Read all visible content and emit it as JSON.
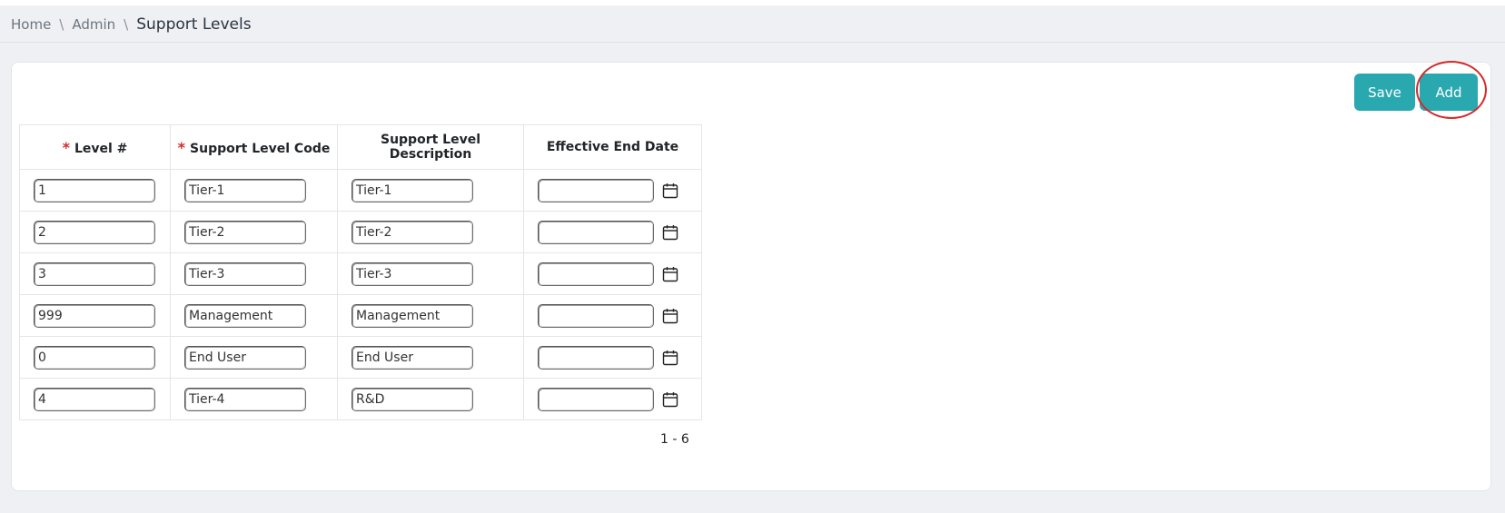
{
  "breadcrumb": {
    "home": "Home",
    "admin": "Admin",
    "current": "Support Levels",
    "separator": "\\"
  },
  "toolbar": {
    "save_label": "Save",
    "add_label": "Add"
  },
  "table": {
    "columns": [
      {
        "label": "Level #",
        "required": true
      },
      {
        "label": "Support Level Code",
        "required": true
      },
      {
        "label": "Support Level Description",
        "required": false
      },
      {
        "label": "Effective End Date",
        "required": false
      }
    ],
    "required_marker": "*",
    "rows": [
      {
        "level": "1",
        "code": "Tier-1",
        "description": "Tier-1",
        "end_date": ""
      },
      {
        "level": "2",
        "code": "Tier-2",
        "description": "Tier-2",
        "end_date": ""
      },
      {
        "level": "3",
        "code": "Tier-3",
        "description": "Tier-3",
        "end_date": ""
      },
      {
        "level": "999",
        "code": "Management",
        "description": "Management",
        "end_date": ""
      },
      {
        "level": "0",
        "code": "End User",
        "description": "End User",
        "end_date": ""
      },
      {
        "level": "4",
        "code": "Tier-4",
        "description": "R&D",
        "end_date": ""
      }
    ]
  },
  "pagination": {
    "range": "1 - 6"
  },
  "colors": {
    "accent": "#2aa8af",
    "required": "#d42a2a",
    "highlight": "#d42a2a",
    "background": "#eef0f4"
  },
  "icons": {
    "calendar": "calendar-icon"
  }
}
